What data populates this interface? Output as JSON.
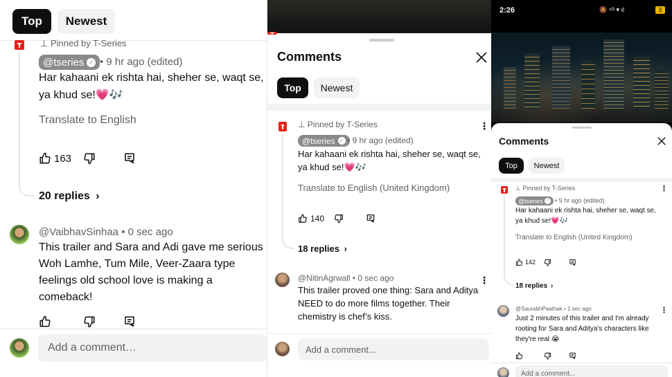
{
  "left_panel": {
    "tabs": [
      "Top",
      "Newest"
    ],
    "pinned_label": "Pinned by T-Series",
    "pinned_comment": {
      "handle": "@tseries",
      "time": "• 9 hr ago (edited)",
      "line1": "Har kahaani ek rishta hai, sheher se, waqt se,",
      "line2": "ya khud se!💗🎶",
      "translate": "Translate to English",
      "likes": "163",
      "replies": "20 replies"
    },
    "second_comment": {
      "author": "@VaibhavSinhaa",
      "time": "• 0 sec ago",
      "lines": [
        "This trailer and Sara and Adi gave me serious",
        "Woh Lamhe, Tum Mile, Veer-Zaara type",
        "feelings old school love is making a",
        "comeback!"
      ]
    },
    "input_placeholder": "Add a comment…"
  },
  "middle_panel": {
    "title": "Comments",
    "tabs": [
      "Top",
      "Newest"
    ],
    "pinned_label": "Pinned by T-Series",
    "pinned_comment": {
      "handle": "@tseries",
      "time": "• 9 hr ago (edited)",
      "line1": "Har kahaani ek rishta hai, sheher se, waqt se,",
      "line2": "ya khud se!💗🎶",
      "translate": "Translate to English (United Kingdom)",
      "likes": "140",
      "replies": "18 replies"
    },
    "second_comment": {
      "author": "@NitinAgrwall",
      "time": "• 0 sec ago",
      "lines": [
        "This trailer proved one thing: Sara and Aditya",
        "NEED to do more films together. Their",
        "chemistry is chef’s kiss."
      ]
    },
    "input_placeholder": "Add a comment..."
  },
  "right_panel": {
    "status_time": "2:26",
    "status_icons": "🔕 ⁴ᴳ ▾ ıl",
    "battery": "3",
    "title": "Comments",
    "tabs": [
      "Top",
      "Newest"
    ],
    "pinned_label": "Pinned by T-Series",
    "pinned_comment": {
      "handle": "@tseries",
      "time": "• 9 hr ago (edited)",
      "line1": "Har kahaani ek rishta hai, sheher se, waqt se,",
      "line2": "ya khud se!💗🎶",
      "translate": "Translate to English (United Kingdom)",
      "likes": "142",
      "replies": "18 replies"
    },
    "second_comment": {
      "author": "@SaurabhPaathak",
      "time": "• 1 sec ago",
      "lines": [
        "Just 2 minutes of this trailer and I'm already",
        "rooting for Sara and Aditya's characters like",
        "they're real 😭"
      ]
    },
    "input_placeholder": "Add a comment..."
  },
  "icons": [
    "thumbs-up-icon",
    "thumbs-down-icon",
    "reply-icon",
    "pin-icon",
    "verified-icon",
    "chevron-right-icon",
    "close-icon",
    "more-vert-icon"
  ]
}
